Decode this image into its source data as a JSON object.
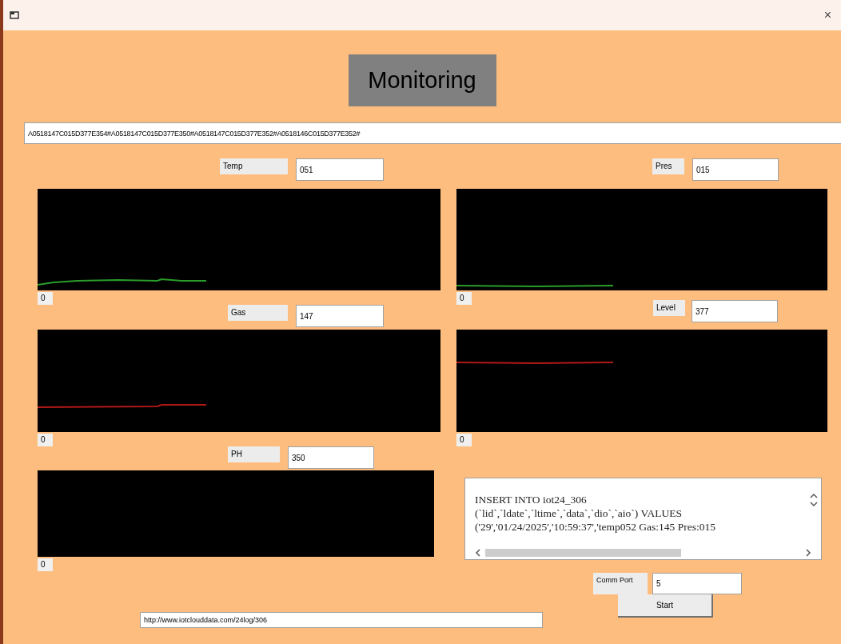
{
  "window": {
    "close": "×"
  },
  "title": "Monitoring",
  "raw_data": "A0518147C015D377E354#A0518147C015D377E350#A0518147C015D377E352#A0518146C015D377E352#",
  "left_sensors": [
    {
      "label": "Temp",
      "value": "051",
      "axis_label": "0",
      "color": "#2a9d2a"
    },
    {
      "label": "Gas",
      "value": "147",
      "axis_label": "0",
      "color": "#b01818"
    },
    {
      "label": "PH",
      "value": "350",
      "axis_label": "0"
    }
  ],
  "right_sensors": [
    {
      "label": "Pres",
      "value": "015",
      "axis_label": "0",
      "color": "#2a9d2a"
    },
    {
      "label": "Level",
      "value": "377",
      "axis_label": "0",
      "color": "#b01818"
    }
  ],
  "log": [
    "INSERT INTO iot24_306",
    "(`lid`,`ldate`,`ltime`,`data`,`dio`,`aio`) VALUES",
    "('29','01/24/2025','10:59:37','temp052  Gas:145  Pres:015"
  ],
  "comm_port": {
    "label": "Comm Port",
    "value": "5"
  },
  "start_button": "Start",
  "url": "http://www.iotclouddata.com/24log/306"
}
